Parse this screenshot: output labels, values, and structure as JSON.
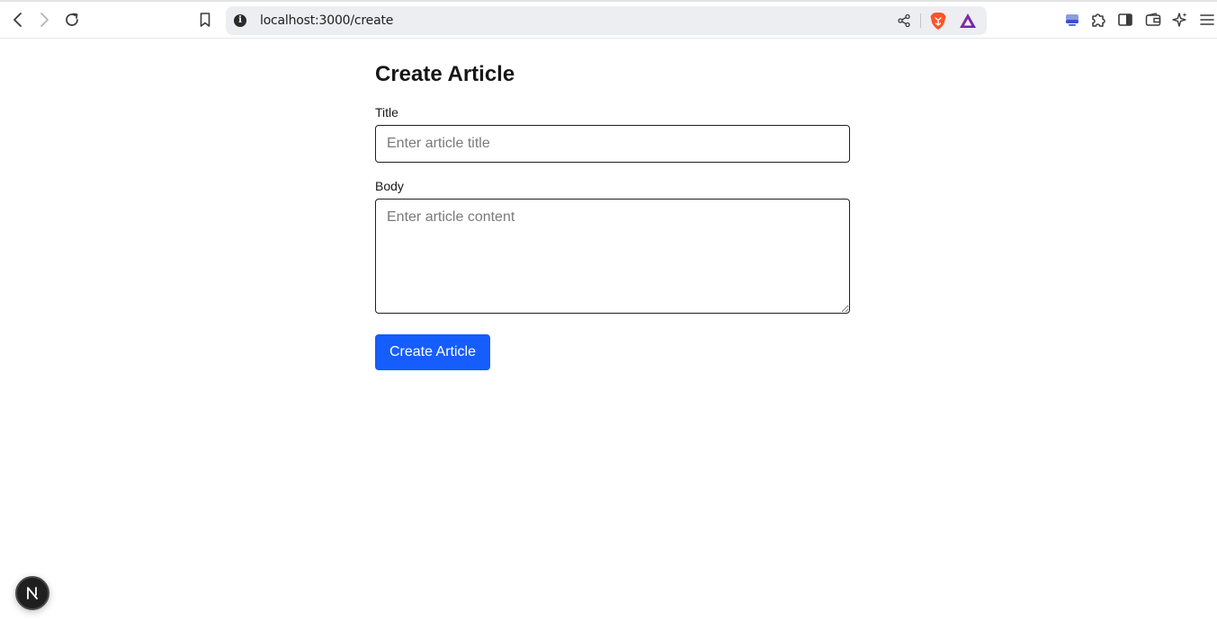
{
  "browser": {
    "url": "localhost:3000/create",
    "info_glyph": "i"
  },
  "page": {
    "heading": "Create Article",
    "title_field": {
      "label": "Title",
      "placeholder": "Enter article title",
      "value": ""
    },
    "body_field": {
      "label": "Body",
      "placeholder": "Enter article content",
      "value": ""
    },
    "submit_label": "Create Article"
  },
  "colors": {
    "accent": "#155dfc",
    "brave": "#fb542b"
  },
  "icons": {
    "back": "back-arrow-icon",
    "forward": "forward-arrow-icon",
    "reload": "reload-icon",
    "bookmark": "bookmark-icon",
    "info": "site-info-icon",
    "share": "share-icon",
    "brave": "brave-shields-icon",
    "rewards": "brave-rewards-icon",
    "vpn": "vpn-icon",
    "extensions": "extensions-puzzle-icon",
    "sidebar": "sidebar-toggle-icon",
    "wallet": "wallet-icon",
    "leo": "leo-ai-icon",
    "menu": "hamburger-menu-icon",
    "next": "nextjs-logo-icon"
  }
}
